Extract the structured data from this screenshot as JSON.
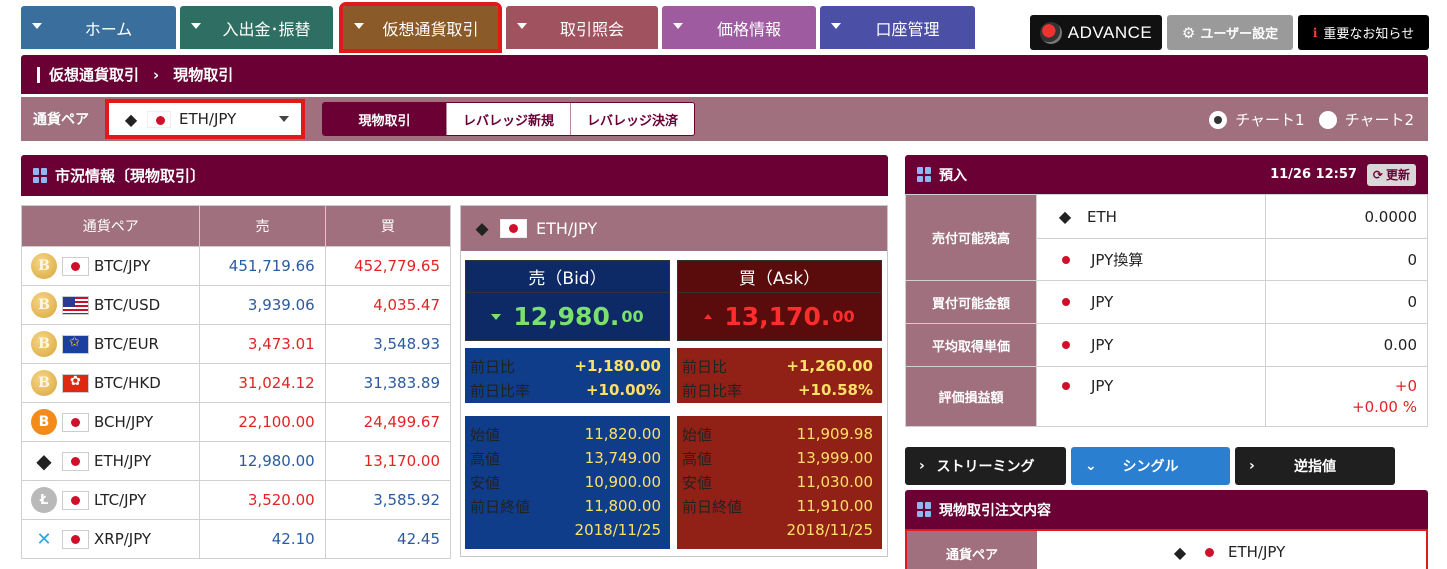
{
  "nav": {
    "tabs": [
      {
        "label": "ホーム",
        "color": "#3a6e9c"
      },
      {
        "label": "入出金･振替",
        "color": "#2f6f63"
      },
      {
        "label": "仮想通貨取引",
        "color": "#8a5a28"
      },
      {
        "label": "取引照会",
        "color": "#a0525f"
      },
      {
        "label": "価格情報",
        "color": "#9e5ba0"
      },
      {
        "label": "口座管理",
        "color": "#4b4fa5"
      }
    ],
    "advance": "ADVANCE",
    "user_settings": "ユーザー設定",
    "notice_icon": "i",
    "notice": "重要なお知らせ"
  },
  "breadcrumb": {
    "parent": "仮想通貨取引",
    "separator": "›",
    "current": "現物取引"
  },
  "pairbar": {
    "label": "通貨ペア",
    "selected_pair": "ETH/JPY",
    "modes": [
      "現物取引",
      "レバレッジ新規",
      "レバレッジ決済"
    ],
    "charts": [
      "チャート1",
      "チャート2"
    ]
  },
  "market": {
    "title": "市況情報〔現物取引〕",
    "headers": [
      "通貨ペア",
      "売",
      "買"
    ],
    "rows": [
      {
        "coin": "B",
        "coin_class": "btc",
        "flag": "jp",
        "pair": "BTC/JPY",
        "sell": "451,719.66",
        "buy": "452,779.65",
        "sell_color": "blue",
        "buy_color": "red"
      },
      {
        "coin": "B",
        "coin_class": "btc",
        "flag": "us",
        "pair": "BTC/USD",
        "sell": "3,939.06",
        "buy": "4,035.47",
        "sell_color": "blue",
        "buy_color": "red"
      },
      {
        "coin": "B",
        "coin_class": "btc",
        "flag": "eu",
        "pair": "BTC/EUR",
        "sell": "3,473.01",
        "buy": "3,548.93",
        "sell_color": "red",
        "buy_color": "blue"
      },
      {
        "coin": "B",
        "coin_class": "btc",
        "flag": "hk",
        "pair": "BTC/HKD",
        "sell": "31,024.12",
        "buy": "31,383.89",
        "sell_color": "red",
        "buy_color": "blue"
      },
      {
        "coin": "B",
        "coin_class": "bch",
        "flag": "jp",
        "pair": "BCH/JPY",
        "sell": "22,100.00",
        "buy": "24,499.67",
        "sell_color": "red",
        "buy_color": "red"
      },
      {
        "coin": "◆",
        "coin_class": "eth",
        "flag": "jp",
        "pair": "ETH/JPY",
        "sell": "12,980.00",
        "buy": "13,170.00",
        "sell_color": "blue",
        "buy_color": "red"
      },
      {
        "coin": "Ł",
        "coin_class": "ltc",
        "flag": "jp",
        "pair": "LTC/JPY",
        "sell": "3,520.00",
        "buy": "3,585.92",
        "sell_color": "red",
        "buy_color": "blue"
      },
      {
        "coin": "✕",
        "coin_class": "xrp",
        "flag": "jp",
        "pair": "XRP/JPY",
        "sell": "42.10",
        "buy": "42.45",
        "sell_color": "blue",
        "buy_color": "blue"
      }
    ]
  },
  "quote": {
    "pair": "ETH/JPY",
    "bid": {
      "title": "売（Bid）",
      "price_main": "12,980.",
      "price_dec": "00",
      "change": "+1,180.00",
      "change_rate": "+10.00%",
      "open": "11,820.00",
      "high": "13,749.00",
      "low": "10,900.00",
      "prev_close": "11,800.00",
      "date": "2018/11/25"
    },
    "ask": {
      "title": "買（Ask）",
      "price_main": "13,170.",
      "price_dec": "00",
      "change": "+1,260.00",
      "change_rate": "+10.58%",
      "open": "11,909.98",
      "high": "13,999.00",
      "low": "11,030.00",
      "prev_close": "11,910.00",
      "date": "2018/11/25"
    },
    "labels": {
      "change": "前日比",
      "change_rate": "前日比率",
      "open": "始値",
      "high": "高値",
      "low": "安値",
      "prev_close": "前日終値"
    }
  },
  "deposit": {
    "title": "預入",
    "datetime": "11/26 12:57",
    "refresh": "更新",
    "rows": {
      "sellable_label": "売付可能残高",
      "eth_cur": "ETH",
      "eth_val": "0.0000",
      "jpy_conv_cur": "JPY換算",
      "jpy_conv_val": "0",
      "buyable_label": "買付可能金額",
      "buyable_cur": "JPY",
      "buyable_val": "0",
      "avg_label": "平均取得単価",
      "avg_cur": "JPY",
      "avg_val": "0.00",
      "pl_label": "評価損益額",
      "pl_cur": "JPY",
      "pl_val": "+0",
      "pl_pct": "+0.00 %"
    }
  },
  "order_tabs": [
    "ストリーミング",
    "シングル",
    "逆指値"
  ],
  "order": {
    "title": "現物取引注文内容",
    "pair_label": "通貨ペア",
    "pair": "ETH/JPY"
  }
}
